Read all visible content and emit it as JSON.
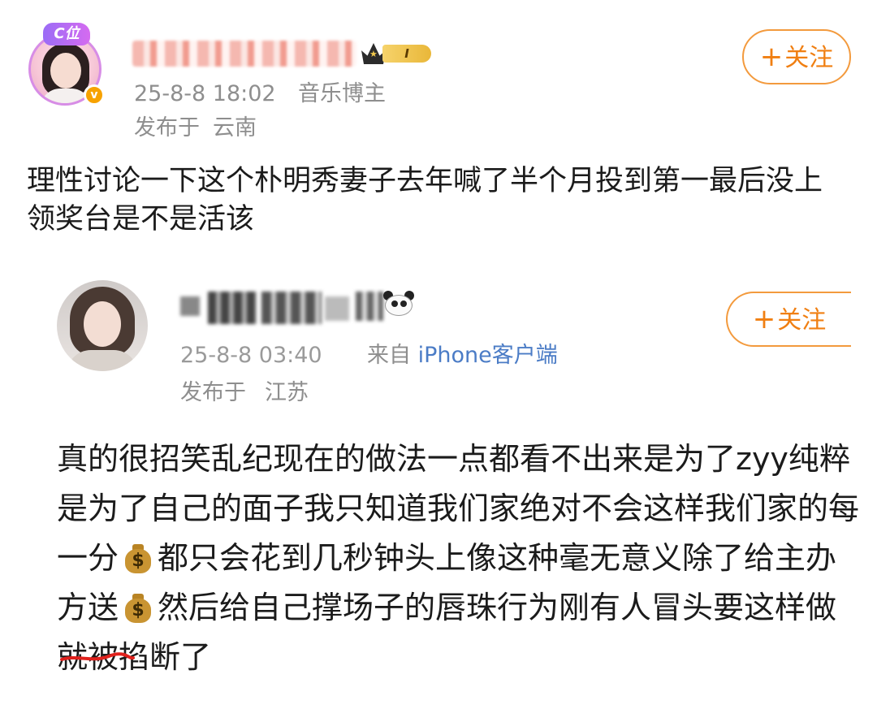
{
  "post1": {
    "avatar_badge": "C位",
    "verified_mark": "v",
    "rank_badge": "I",
    "follow_label": "关注",
    "time": "25-8-8 18:02",
    "role": "音乐博主",
    "location_label": "发布于",
    "location": "云南",
    "text": "理性讨论一下这个朴明秀妻子去年喊了半个月投到第一最后没上领奖台是不是活该"
  },
  "post2": {
    "follow_label": "关注",
    "time": "25-8-8 03:40",
    "source_label": "来自",
    "source_client": "iPhone客户端",
    "location_label": "发布于",
    "location": "江苏",
    "text_parts": [
      "真的很招笑乱纪现在的做法一点都看不出来是为了zyy纯粹是为了自己的面子我只知道我们家绝对不会这样我们家的每一分",
      "都只会花到几秒钟头上像这种毫无意义除了给主办方送",
      "然后给自己撑场子的",
      "行为刚有人冒头要这样做就被掐断了"
    ],
    "redacted_text": "唇珠",
    "emoji_name": "money-bag-icon"
  },
  "colors": {
    "follow_orange": "#f07f12",
    "meta_gray": "#8e8e8e",
    "link_blue": "#4b7cc6",
    "scribble_red": "#e0211c"
  }
}
